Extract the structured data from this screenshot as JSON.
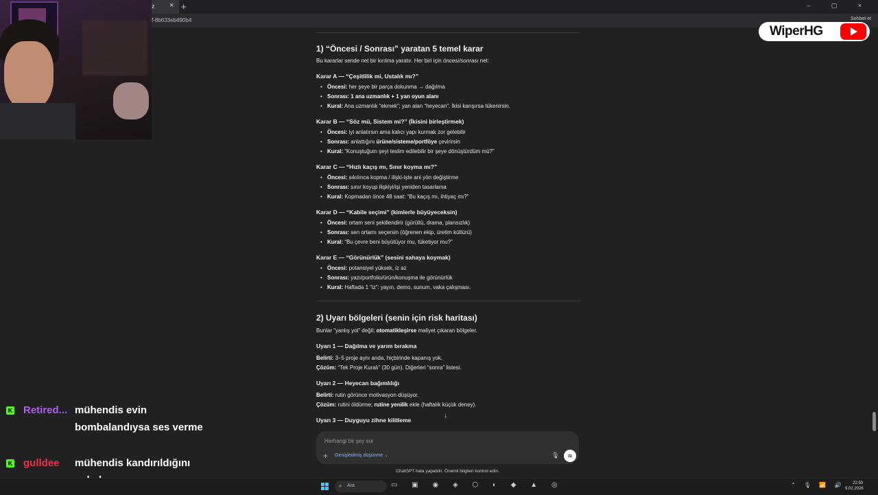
{
  "browser": {
    "tab_title": "z",
    "tab_close": "×",
    "new_tab": "+",
    "window_controls": "– ▢ ×",
    "url": "f-8b633eb490b4",
    "top_right": "Sohbet et"
  },
  "logo": {
    "text": "WiperHG"
  },
  "section1": {
    "title": "1) “Öncesi / Sonrası” yaratan 5 temel karar",
    "intro_a": "Bu kararlar sende net bir kırılma yaratır. Her biri için ",
    "intro_b": "öncesi/sonrası",
    "intro_c": " net:",
    "decisions": [
      {
        "heading": "Karar A — “Çeşitlilik mi, Ustalık mı?”",
        "items": [
          {
            "label": "Öncesi:",
            "text": " her şeye bir parça dokunma → dağılma"
          },
          {
            "label": "Sonrası: 1 ana uzmanlık + 1 yan oyun alanı",
            "text": ""
          },
          {
            "label": "Kural:",
            "text": " Ana uzmanlık “ekmek”; yan alan “heyecan”. İkisi karışırsa tükenirsin."
          }
        ]
      },
      {
        "heading": "Karar B — “Söz mü, Sistem mi?” (İkisini birleştirmek)",
        "items": [
          {
            "label": "Öncesi:",
            "text": " iyi anlatırsın ama kalıcı yapı kurmak zor gelebilir"
          },
          {
            "label": "Sonrası:",
            "text": " anlattığını ",
            "bold2": "ürüne/sisteme/portföye",
            "text2": " çevirirsin"
          },
          {
            "label": "Kural:",
            "text": " “Konuştuğum şeyi teslim edilebilir bir şeye dönüştürdüm mü?”"
          }
        ]
      },
      {
        "heading": "Karar C — “Hızlı kaçış mı, Sınır koyma mı?”",
        "items": [
          {
            "label": "Öncesi:",
            "text": " sıkılınca kopma / ilişki-işte ani yön değiştirme"
          },
          {
            "label": "Sonrası:",
            "text": " sınır koyup ilişkiyi/işi yeniden tasarlama"
          },
          {
            "label": "Kural:",
            "text": " Kopmadan önce 48 saat: “Bu kaçış mı, ihtiyaç mı?”"
          }
        ]
      },
      {
        "heading": "Karar D — “Kabile seçimi” (kimlerle büyüyeceksin)",
        "items": [
          {
            "label": "Öncesi:",
            "text": " ortam seni şekillendirir (gürültü, drama, plansızlık)"
          },
          {
            "label": "Sonrası:",
            "text": " sen ortamı seçersin (öğrenen ekip, üretim kültürü)"
          },
          {
            "label": "Kural:",
            "text": " “Bu çevre beni büyütüyor mu, tüketiyor mu?”"
          }
        ]
      },
      {
        "heading": "Karar E — “Görünürlük” (sesini sahaya koymak)",
        "items": [
          {
            "label": "Öncesi:",
            "text": " potansiyel yüksek, iz az"
          },
          {
            "label": "Sonrası:",
            "text": " yazı/portfolio/ürün/konuşma ile görünürlük"
          },
          {
            "label": "Kural:",
            "text": " Haftada 1 “iz”: yayın, demo, sunum, vaka çalışması."
          }
        ]
      }
    ]
  },
  "section2": {
    "title": "2) Uyarı bölgeleri (senin için risk haritası)",
    "intro_a": "Bunlar “yanlış yol” değil; ",
    "intro_b": "otomatikleşirse",
    "intro_c": " maliyet çıkaran bölgeler.",
    "warnings": [
      {
        "heading": "Uyarı 1 — Dağılma ve yarım bırakma",
        "lines": [
          {
            "label": "Belirti:",
            "text": " 3–5 proje aynı anda, hiçbirinde kapanış yok."
          },
          {
            "label": "Çözüm:",
            "text": " “Tek Proje Kuralı” (30 gün). Diğerleri “sonra” listesi."
          }
        ]
      },
      {
        "heading": "Uyarı 2 — Heyecan bağımlılığı",
        "lines": [
          {
            "label": "Belirti:",
            "text": " rutin görünce motivasyon düşüyor."
          },
          {
            "label": "Çözüm:",
            "text": " rutini öldürme; ",
            "bold2": "rutine yenilik",
            "text2": " ekle (haftalık küçük deney)."
          }
        ]
      },
      {
        "heading": "Uyarı 3 — Duyguyu zihne kilitleme",
        "lines": []
      }
    ]
  },
  "scroll_down_icon": "↓",
  "composer": {
    "placeholder": "Herhangi bir şey sor",
    "plus": "+",
    "mode": "Genişletilmiş düşünme",
    "mode_caret": "⌄",
    "mic": "🎙",
    "voice": "≋"
  },
  "disclaimer": "ChatGPT hata yapabilir. Önemli bilgileri kontrol edin.",
  "chat_overlay": [
    {
      "badge": "K",
      "user": "Retired...",
      "user_color": "#b05cf0",
      "text": "mühendis evin bombalandıysa ses verme"
    },
    {
      "badge": "K",
      "user": "gulldee",
      "user_color": "#e8334a",
      "text": "mühendis kandırıldığını anladı"
    }
  ],
  "taskbar": {
    "search_label": "Ara",
    "search_icon": "⌕",
    "app_icons": "▭ ▣ ◉ ◈ ⬡ ◐ ◆ ▲ ◎",
    "tray_icons": "⌃ 🎙 📶 🔊",
    "time": "22:50",
    "date": "9.02.2026"
  }
}
